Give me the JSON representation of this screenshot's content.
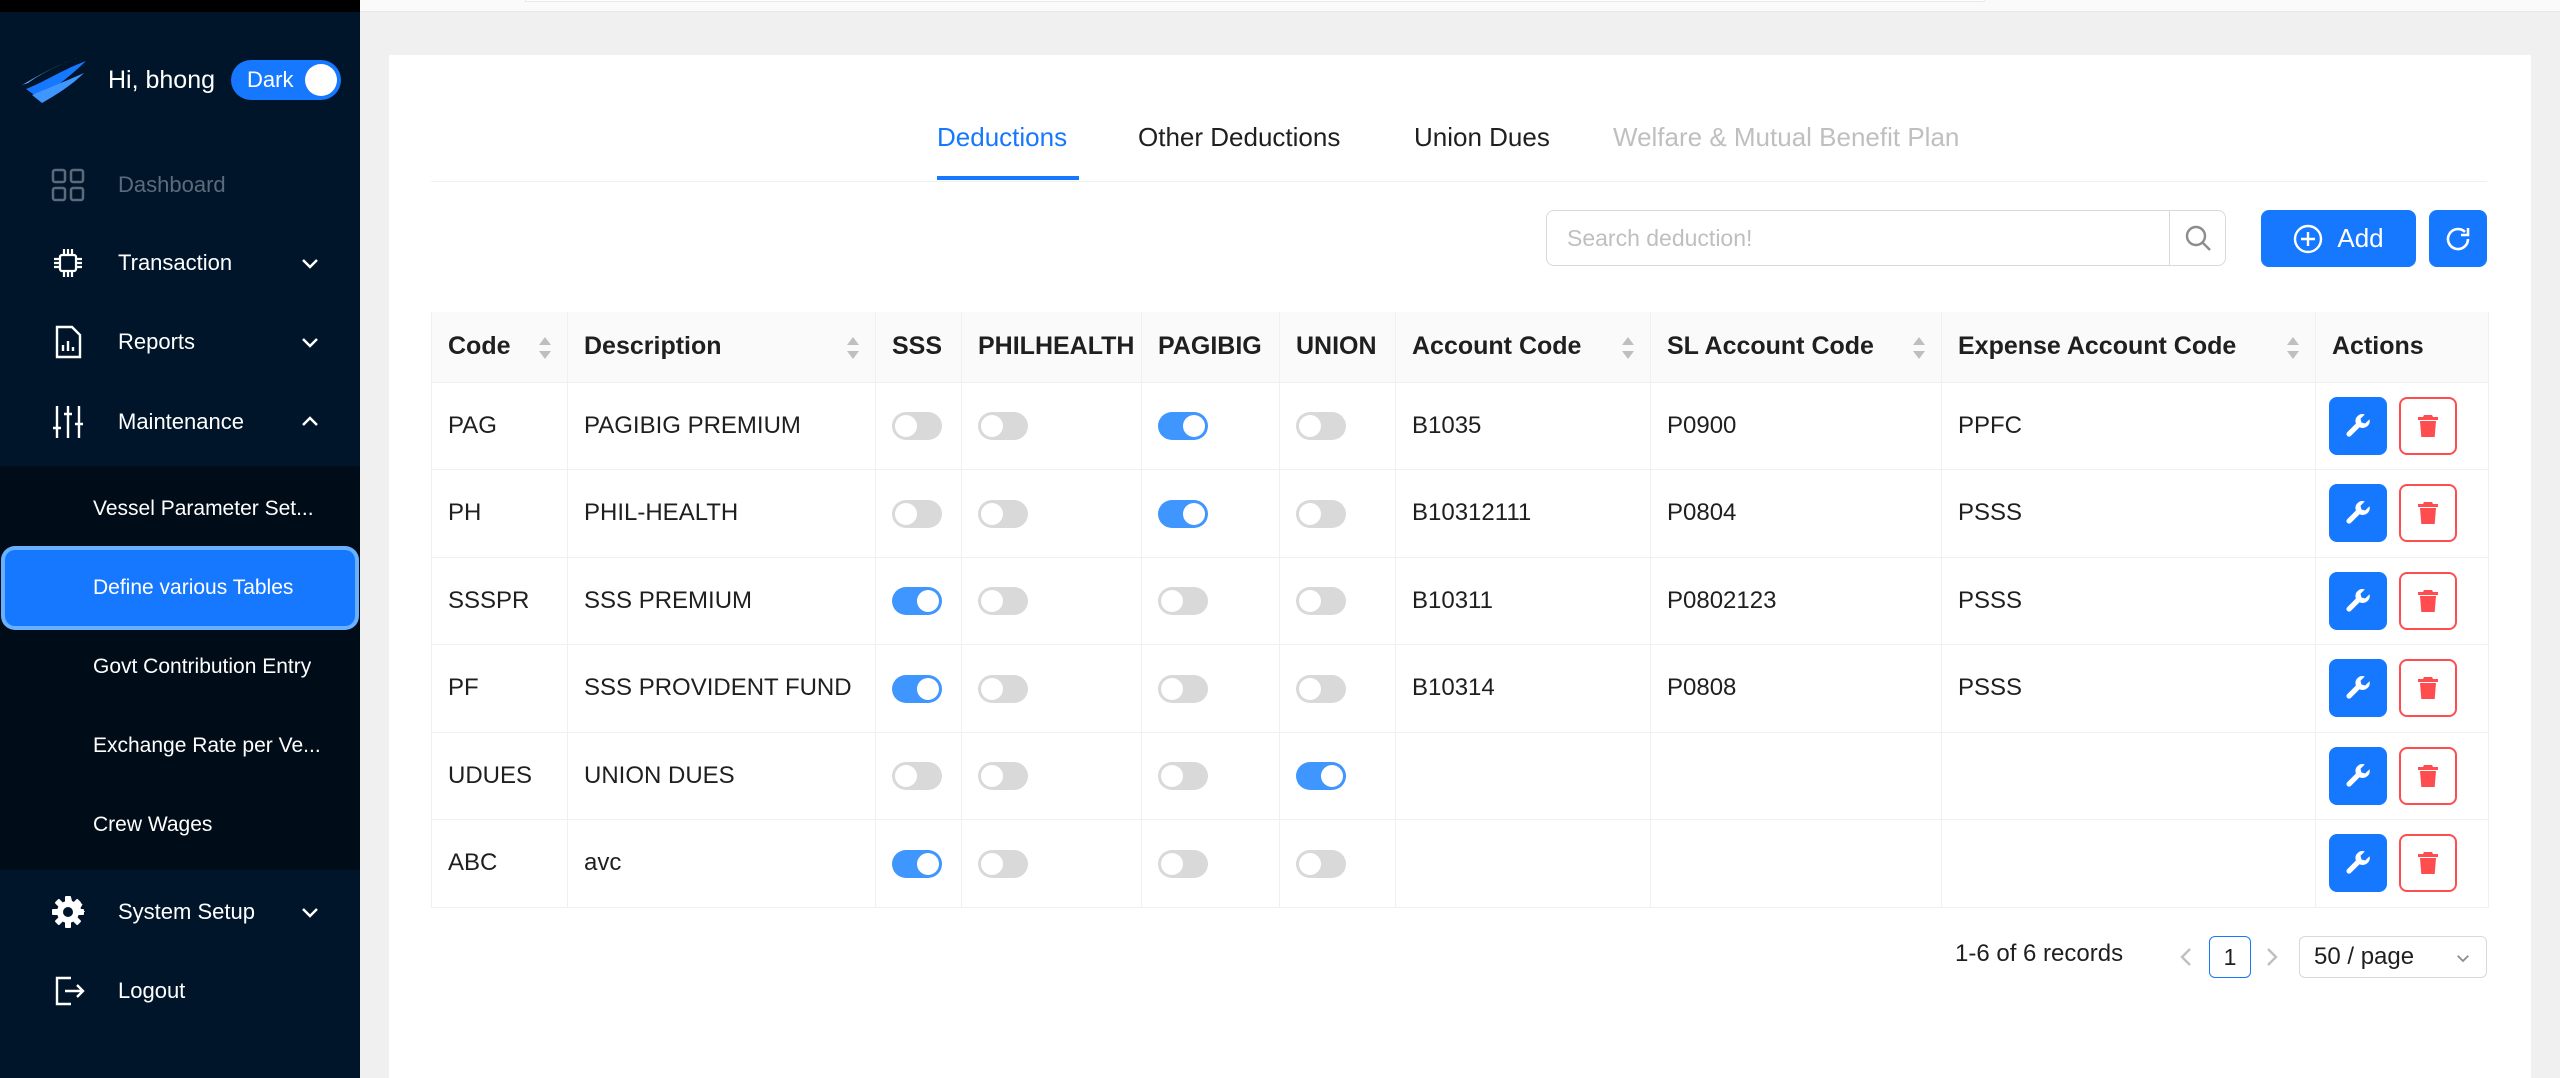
{
  "user": {
    "greeting": "Hi, bhong",
    "theme_label": "Dark"
  },
  "sidebar": {
    "items": [
      {
        "label": "Dashboard",
        "icon": "dashboard-icon",
        "disabled": true
      },
      {
        "label": "Transaction",
        "icon": "transaction-icon"
      },
      {
        "label": "Reports",
        "icon": "reports-icon"
      },
      {
        "label": "Maintenance",
        "icon": "maintenance-icon",
        "expanded": true
      },
      {
        "label": "System Setup",
        "icon": "gear-icon"
      },
      {
        "label": "Logout",
        "icon": "logout-icon"
      }
    ],
    "maintenance_sub": [
      {
        "label": "Vessel Parameter Set..."
      },
      {
        "label": "Define various Tables",
        "selected": true
      },
      {
        "label": "Govt Contribution Entry"
      },
      {
        "label": "Exchange Rate per Ve..."
      },
      {
        "label": "Crew Wages"
      }
    ]
  },
  "tabs": [
    {
      "label": "Deductions",
      "state": "active"
    },
    {
      "label": "Other Deductions",
      "state": "normal"
    },
    {
      "label": "Union Dues",
      "state": "normal"
    },
    {
      "label": "Welfare & Mutual Benefit Plan",
      "state": "disabled"
    }
  ],
  "toolbar": {
    "search_placeholder": "Search deduction!",
    "add_label": "Add"
  },
  "table": {
    "columns": [
      "Code",
      "Description",
      "SSS",
      "PHILHEALTH",
      "PAGIBIG",
      "UNION",
      "Account Code",
      "SL Account Code",
      "Expense Account Code",
      "Actions"
    ],
    "rows": [
      {
        "code": "PAG",
        "description": "PAGIBIG PREMIUM",
        "sss": false,
        "philhealth": false,
        "pagibig": true,
        "union": false,
        "account_code": "B1035",
        "sl_account_code": "P0900",
        "expense_account_code": "PPFC"
      },
      {
        "code": "PH",
        "description": "PHIL-HEALTH",
        "sss": false,
        "philhealth": false,
        "pagibig": true,
        "union": false,
        "account_code": "B10312111",
        "sl_account_code": "P0804",
        "expense_account_code": "PSSS"
      },
      {
        "code": "SSSPR",
        "description": "SSS PREMIUM",
        "sss": true,
        "philhealth": false,
        "pagibig": false,
        "union": false,
        "account_code": "B10311",
        "sl_account_code": "P0802123",
        "expense_account_code": "PSSS"
      },
      {
        "code": "PF",
        "description": "SSS PROVIDENT FUND",
        "sss": true,
        "philhealth": false,
        "pagibig": false,
        "union": false,
        "account_code": "B10314",
        "sl_account_code": "P0808",
        "expense_account_code": "PSSS"
      },
      {
        "code": "UDUES",
        "description": "UNION DUES",
        "sss": false,
        "philhealth": false,
        "pagibig": false,
        "union": true,
        "account_code": "",
        "sl_account_code": "",
        "expense_account_code": ""
      },
      {
        "code": "ABC",
        "description": "avc",
        "sss": true,
        "philhealth": false,
        "pagibig": false,
        "union": false,
        "account_code": "",
        "sl_account_code": "",
        "expense_account_code": ""
      }
    ]
  },
  "pagination": {
    "total_text": "1-6 of 6 records",
    "current_page": "1",
    "page_size": "50 / page"
  },
  "colors": {
    "sidebar_bg": "#001529",
    "submenu_bg": "#000c17",
    "primary": "#1677ff",
    "switch_on": "#4096ff",
    "switch_off": "#d9d9d9",
    "danger": "#ff4d4f"
  }
}
